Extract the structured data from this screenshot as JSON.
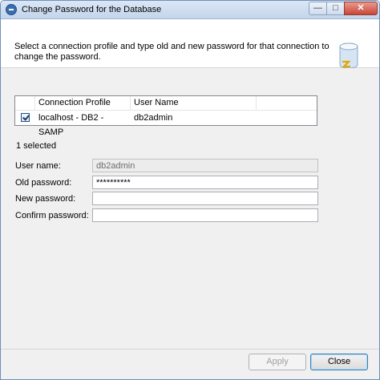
{
  "window": {
    "title": "Change Password for the Database",
    "minimize_glyph": "—",
    "maximize_glyph": "□",
    "close_glyph": "✕"
  },
  "header": {
    "description": "Select a connection profile and type old and new password for that connection to change the password."
  },
  "table": {
    "columns": [
      "Connection Profile",
      "User Name"
    ],
    "rows": [
      {
        "checked": true,
        "profile": "localhost - DB2 - SAMP",
        "user": "db2admin"
      }
    ]
  },
  "selection": {
    "count_label": "1 selected"
  },
  "form": {
    "user_name": {
      "label": "User name:",
      "value": "db2admin"
    },
    "old_password": {
      "label": "Old password:",
      "value": "**********"
    },
    "new_password": {
      "label": "New password:",
      "value": ""
    },
    "confirm_password": {
      "label": "Confirm password:",
      "value": ""
    }
  },
  "buttons": {
    "apply": "Apply",
    "close": "Close"
  },
  "icons": {
    "window_icon": "app-icon",
    "banner_icon": "database-icon"
  },
  "colors": {
    "title_bar": "#c3d5ec",
    "accent": "#3c7fb1",
    "close_button": "#c9463a"
  }
}
